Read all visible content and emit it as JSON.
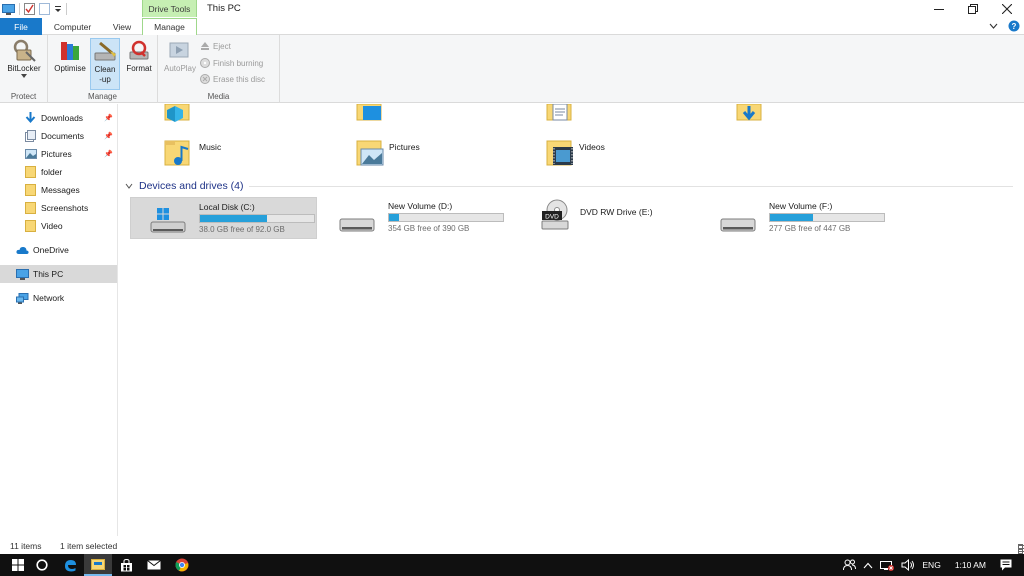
{
  "window": {
    "title": "This PC",
    "context_tab_group": "Drive Tools"
  },
  "tabs": {
    "file": "File",
    "computer": "Computer",
    "view": "View",
    "manage": "Manage"
  },
  "ribbon": {
    "protect": {
      "label": "Protect",
      "bitlocker": "BitLocker"
    },
    "manage": {
      "label": "Manage",
      "optimise": "Optimise",
      "cleanup_line1": "Clean",
      "cleanup_line2": "-up",
      "format": "Format"
    },
    "media": {
      "label": "Media",
      "autoplay": "AutoPlay",
      "eject": "Eject",
      "finish_burning": "Finish burning",
      "erase": "Erase this disc"
    }
  },
  "sidebar": {
    "items": [
      {
        "label": "Downloads",
        "icon": "download-arrow-icon",
        "pinned": true
      },
      {
        "label": "Documents",
        "icon": "documents-icon",
        "pinned": true
      },
      {
        "label": "Pictures",
        "icon": "pictures-icon",
        "pinned": true
      },
      {
        "label": "folder",
        "icon": "folder-icon",
        "pinned": false
      },
      {
        "label": "Messages",
        "icon": "folder-icon",
        "pinned": false
      },
      {
        "label": "Screenshots",
        "icon": "folder-icon",
        "pinned": false
      },
      {
        "label": "Video",
        "icon": "folder-icon",
        "pinned": false
      },
      {
        "label": "OneDrive",
        "icon": "cloud-icon",
        "pinned": false
      },
      {
        "label": "This PC",
        "icon": "computer-icon",
        "pinned": false
      },
      {
        "label": "Network",
        "icon": "network-icon",
        "pinned": false
      }
    ]
  },
  "folders": [
    {
      "label": "Music"
    },
    {
      "label": "Pictures"
    },
    {
      "label": "Videos"
    }
  ],
  "devices": {
    "heading": "Devices and drives (4)",
    "drives": [
      {
        "name": "Local Disk (C:)",
        "free": "38.0 GB free of 92.0 GB",
        "used_fraction": 0.587
      },
      {
        "name": "New Volume (D:)",
        "free": "354 GB free of 390 GB",
        "used_fraction": 0.092
      },
      {
        "name": "DVD RW Drive (E:)",
        "free": "",
        "used_fraction": null
      },
      {
        "name": "New Volume (F:)",
        "free": "277 GB free of 447 GB",
        "used_fraction": 0.38
      }
    ]
  },
  "statusbar": {
    "items_count": "11 items",
    "selection": "1 item selected"
  },
  "taskbar": {
    "language": "ENG",
    "time": "1:10 AM"
  },
  "colors": {
    "accent": "#1979ca",
    "context_tab": "#c6efb3",
    "progress_fill": "#26a0da",
    "taskbar": "#101010"
  }
}
